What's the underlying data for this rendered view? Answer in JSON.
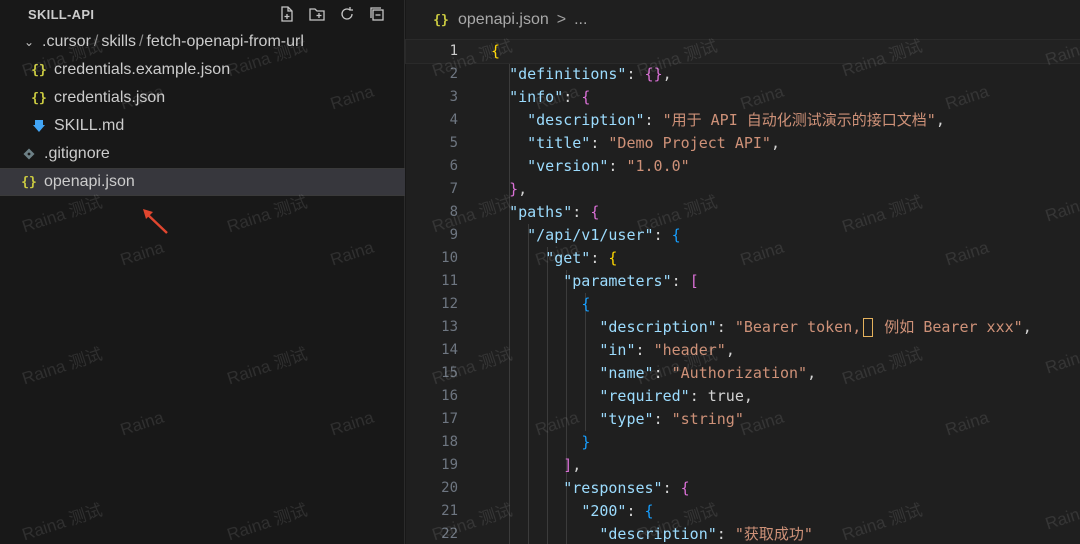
{
  "explorer": {
    "title": "SKILL-API",
    "folder": {
      "segments": [
        ".cursor",
        "skills",
        "fetch-openapi-from-url"
      ],
      "separator": "/"
    },
    "files": [
      {
        "name": "credentials.example.json",
        "icon": "json-icon",
        "selected": false
      },
      {
        "name": "credentials.json",
        "icon": "json-icon",
        "selected": false
      },
      {
        "name": "SKILL.md",
        "icon": "markdown-icon",
        "selected": false
      },
      {
        "name": ".gitignore",
        "icon": "git-icon",
        "selected": false
      },
      {
        "name": "openapi.json",
        "icon": "json-icon",
        "selected": true
      }
    ],
    "actions": [
      "new-file-icon",
      "new-folder-icon",
      "refresh-icon",
      "collapse-all-icon"
    ]
  },
  "editor": {
    "breadcrumb": {
      "file": "openapi.json",
      "separator": ">",
      "more": "..."
    },
    "active_line": 1,
    "lines": [
      {
        "n": "1",
        "t": "{"
      },
      {
        "n": "2",
        "t": "  \"definitions\": {},"
      },
      {
        "n": "3",
        "t": "  \"info\": {"
      },
      {
        "n": "4",
        "t": "    \"description\": \"用于 API 自动化测试演示的接口文档\","
      },
      {
        "n": "5",
        "t": "    \"title\": \"Demo Project API\","
      },
      {
        "n": "6",
        "t": "    \"version\": \"1.0.0\""
      },
      {
        "n": "7",
        "t": "  },"
      },
      {
        "n": "8",
        "t": "  \"paths\": {"
      },
      {
        "n": "9",
        "t": "    \"/api/v1/user\": {"
      },
      {
        "n": "10",
        "t": "      \"get\": {"
      },
      {
        "n": "11",
        "t": "        \"parameters\": ["
      },
      {
        "n": "12",
        "t": "          {"
      },
      {
        "n": "13",
        "t": "            \"description\": \"Bearer token, 例如 Bearer xxx\","
      },
      {
        "n": "14",
        "t": "            \"in\": \"header\","
      },
      {
        "n": "15",
        "t": "            \"name\": \"Authorization\","
      },
      {
        "n": "16",
        "t": "            \"required\": true,"
      },
      {
        "n": "17",
        "t": "            \"type\": \"string\""
      },
      {
        "n": "18",
        "t": "          }"
      },
      {
        "n": "19",
        "t": "        ],"
      },
      {
        "n": "20",
        "t": "        \"responses\": {"
      },
      {
        "n": "21",
        "t": "          \"200\": {"
      },
      {
        "n": "22",
        "t": "            \"description\": \"获取成功\""
      }
    ]
  },
  "watermark": "Raina 测试",
  "watermark_short": "Raina",
  "colors": {
    "key": "#9cdcfe",
    "string": "#ce9178",
    "brace1": "#ffd700",
    "brace2": "#da70d6",
    "brace3": "#179fff",
    "json_icon": "#cbcb41",
    "arrow": "#e0462f"
  }
}
